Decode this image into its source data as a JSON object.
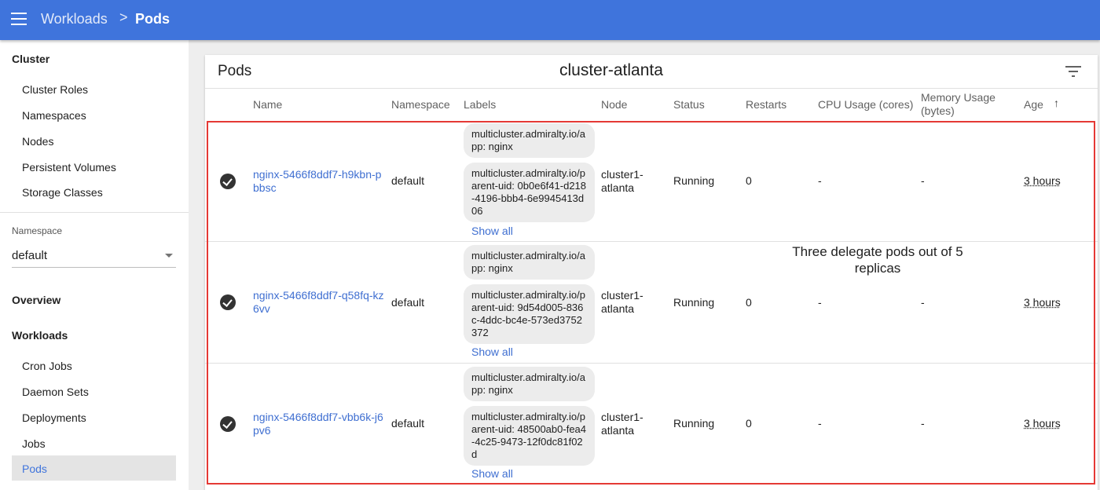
{
  "header": {
    "breadcrumb_parent": "Workloads",
    "breadcrumb_separator": ">",
    "breadcrumb_current": "Pods",
    "bar_color": "#3f74dc"
  },
  "sidebar": {
    "cluster_section": "Cluster",
    "cluster_items": [
      "Cluster Roles",
      "Namespaces",
      "Nodes",
      "Persistent Volumes",
      "Storage Classes"
    ],
    "namespace_label": "Namespace",
    "namespace_value": "default",
    "overview": "Overview",
    "workloads_section": "Workloads",
    "workload_items": [
      "Cron Jobs",
      "Daemon Sets",
      "Deployments",
      "Jobs",
      "Pods"
    ],
    "active_item": "Pods"
  },
  "main": {
    "title": "Pods",
    "cluster_name": "cluster-atlanta",
    "columns": {
      "name": "Name",
      "namespace": "Namespace",
      "labels": "Labels",
      "node": "Node",
      "status": "Status",
      "restarts": "Restarts",
      "cpu": "CPU Usage (cores)",
      "memory": "Memory Usage (bytes)",
      "age": "Age"
    },
    "sort_indicator": "↑",
    "pods": [
      {
        "name": "nginx-5466f8ddf7-h9kbn-pbbsc",
        "namespace": "default",
        "label_app": "multicluster.admiralty.io/app: nginx",
        "label_parent": "multicluster.admiralty.io/parent-uid: 0b0e6f41-d218-4196-bbb4-6e9945413d06",
        "show_all": "Show all",
        "node": "cluster1-atlanta",
        "status": "Running",
        "restarts": "0",
        "cpu": "-",
        "memory": "-",
        "age": "3 hours"
      },
      {
        "name": "nginx-5466f8ddf7-q58fq-kz6vv",
        "namespace": "default",
        "label_app": "multicluster.admiralty.io/app: nginx",
        "label_parent": "multicluster.admiralty.io/parent-uid: 9d54d005-836c-4ddc-bc4e-573ed3752372",
        "show_all": "Show all",
        "node": "cluster1-atlanta",
        "status": "Running",
        "restarts": "0",
        "cpu": "-",
        "memory": "-",
        "age": "3 hours"
      },
      {
        "name": "nginx-5466f8ddf7-vbb6k-j6pv6",
        "namespace": "default",
        "label_app": "multicluster.admiralty.io/app: nginx",
        "label_parent": "multicluster.admiralty.io/parent-uid: 48500ab0-fea4-4c25-9473-12f0dc81f02d",
        "show_all": "Show all",
        "node": "cluster1-atlanta",
        "status": "Running",
        "restarts": "0",
        "cpu": "-",
        "memory": "-",
        "age": "3 hours"
      }
    ],
    "annotation": "Three delegate pods out of 5 replicas",
    "annotation_box_color": "#e53935",
    "status_icon": "check-circle-icon"
  }
}
